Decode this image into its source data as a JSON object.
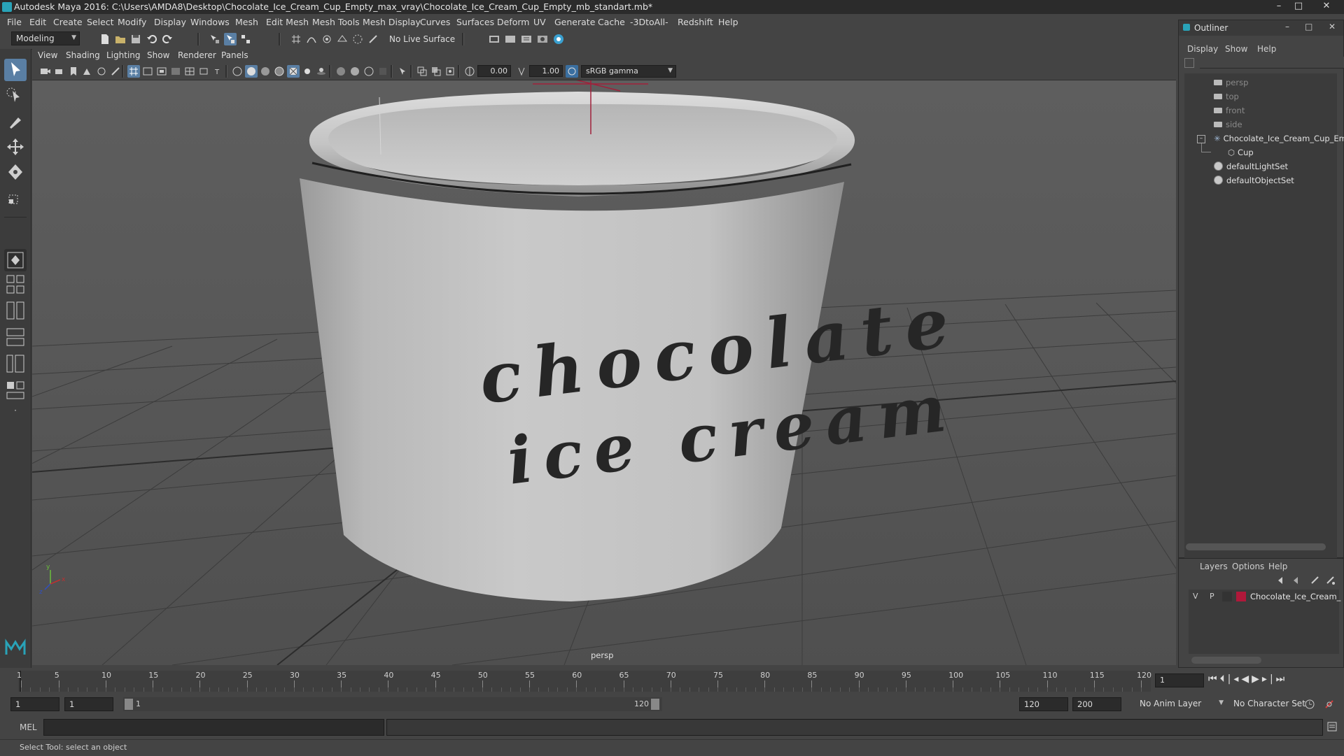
{
  "window": {
    "title": "Autodesk Maya 2016: C:\\Users\\AMDA8\\Desktop\\Chocolate_Ice_Cream_Cup_Empty_max_vray\\Chocolate_Ice_Cream_Cup_Empty_mb_standart.mb*",
    "minimize": "–",
    "maximize": "□",
    "close": "✕"
  },
  "menubar": {
    "items": [
      "File",
      "Edit",
      "Create",
      "Select",
      "Modify",
      "Display",
      "Windows",
      "Mesh",
      "Edit Mesh",
      "Mesh Tools",
      "Mesh Display",
      "Curves",
      "Surfaces",
      "Deform",
      "UV",
      "Generate",
      "Cache",
      "-3DtoAll-",
      "Redshift",
      "Help"
    ]
  },
  "statusline": {
    "mode": "Modeling",
    "live_surface": "No Live Surface"
  },
  "panel": {
    "menus": [
      "View",
      "Shading",
      "Lighting",
      "Show",
      "Renderer",
      "Panels"
    ],
    "exposure": "0.00",
    "gamma": "1.00",
    "color_space": "sRGB gamma",
    "camera_label": "persp"
  },
  "model": {
    "label_line1": "chocolate",
    "label_line2": "ice cream"
  },
  "outliner": {
    "title": "Outliner",
    "menus": [
      "Display",
      "Show",
      "Help"
    ],
    "items": [
      {
        "label": "persp",
        "kind": "camera"
      },
      {
        "label": "top",
        "kind": "camera"
      },
      {
        "label": "front",
        "kind": "camera"
      },
      {
        "label": "side",
        "kind": "camera"
      },
      {
        "label": "Chocolate_Ice_Cream_Cup_Em",
        "kind": "group"
      },
      {
        "label": "Cup",
        "kind": "mesh"
      },
      {
        "label": "defaultLightSet",
        "kind": "set"
      },
      {
        "label": "defaultObjectSet",
        "kind": "set"
      }
    ]
  },
  "layers": {
    "menus": [
      "Layers",
      "Options",
      "Help"
    ],
    "row": {
      "visible": "V",
      "playback": "P",
      "name": "Chocolate_Ice_Cream_",
      "color": "#b0183a"
    }
  },
  "timeslider": {
    "ticks": [
      "1",
      "5",
      "10",
      "15",
      "20",
      "25",
      "30",
      "35",
      "40",
      "45",
      "50",
      "55",
      "60",
      "65",
      "70",
      "75",
      "80",
      "85",
      "90",
      "95",
      "100",
      "105",
      "110",
      "115",
      "120"
    ],
    "current_frame": "1"
  },
  "range": {
    "start_field": "1",
    "start2_field": "1",
    "range_start": "1",
    "range_end": "120",
    "end_field": "120",
    "end2_field": "200",
    "anim_layer": "No Anim Layer",
    "char_set": "No Character Set"
  },
  "command": {
    "language": "MEL"
  },
  "help": {
    "text": "Select Tool: select an object"
  },
  "colors": {
    "accent": "#5a7fa4",
    "maya_teal": "#29a3b8",
    "layer_red": "#b0183a"
  }
}
